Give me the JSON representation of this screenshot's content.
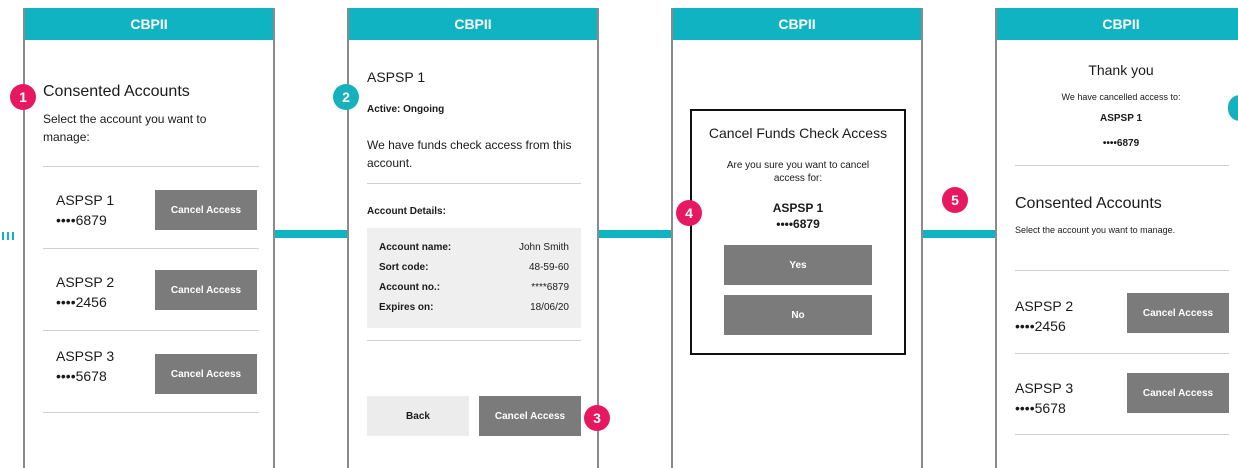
{
  "brand": "CBPII",
  "screen1": {
    "title": "Consented Accounts",
    "subtitle": "Select the account you want to manage:",
    "accounts": [
      {
        "name": "ASPSP 1",
        "number": "••••6879",
        "button": "Cancel Access"
      },
      {
        "name": "ASPSP 2",
        "number": "••••2456",
        "button": "Cancel Access"
      },
      {
        "name": "ASPSP 3",
        "number": "••••5678",
        "button": "Cancel Access"
      }
    ]
  },
  "screen2": {
    "bank": "ASPSP 1",
    "status": "Active: Ongoing",
    "description": "We have funds check access from this account.",
    "details_title": "Account Details:",
    "details": [
      {
        "label": "Account name:",
        "value": "John Smith"
      },
      {
        "label": "Sort code:",
        "value": "48-59-60"
      },
      {
        "label": "Account no.:",
        "value": "****6879"
      },
      {
        "label": "Expires on:",
        "value": "18/06/20"
      }
    ],
    "back_button": "Back",
    "cancel_button": "Cancel Access"
  },
  "screen3": {
    "dialog_title": "Cancel Funds Check Access",
    "dialog_text": "Are you sure you want to cancel access for:",
    "bank": "ASPSP 1",
    "number": "••••6879",
    "yes_button": "Yes",
    "no_button": "No"
  },
  "screen4": {
    "thanks": "Thank you",
    "cancelled_text": "We have cancelled access to:",
    "bank": "ASPSP 1",
    "number": "••••6879",
    "title": "Consented Accounts",
    "subtitle": "Select the account you want to manage.",
    "accounts": [
      {
        "name": "ASPSP 2",
        "number": "••••2456",
        "button": "Cancel Access"
      },
      {
        "name": "ASPSP 3",
        "number": "••••5678",
        "button": "Cancel Access"
      }
    ]
  },
  "steps": [
    "1",
    "2",
    "3",
    "4",
    "5"
  ],
  "colors": {
    "accent": "#0fb3c2",
    "step_pink": "#e6185f",
    "step_teal": "#17b0bd",
    "button": "#7b7b7b"
  }
}
